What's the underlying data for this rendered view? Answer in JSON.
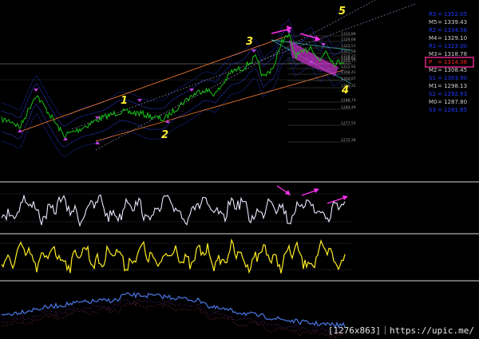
{
  "chart_data": [
    {
      "type": "line",
      "panel": "price",
      "series": [],
      "wave_labels": [
        "1",
        "2",
        "3",
        "4",
        "5"
      ],
      "pivot_levels": [
        {
          "label": "R3",
          "value": "1352.05",
          "color": "#1e3cff",
          "highlight": false
        },
        {
          "label": "M5",
          "value": "1339.43",
          "color": "#d0d0d0",
          "highlight": false
        },
        {
          "label": "R2",
          "value": "1334.56",
          "color": "#1e3cff",
          "highlight": false
        },
        {
          "label": "M4",
          "value": "1329.10",
          "color": "#d0d0d0",
          "highlight": false
        },
        {
          "label": "R1",
          "value": "1323.00",
          "color": "#1e3cff",
          "highlight": false
        },
        {
          "label": "M3",
          "value": "1318.78",
          "color": "#d0d0d0",
          "highlight": false
        },
        {
          "label": "P",
          "value": "1314.36",
          "color": "#ff2020",
          "highlight": true
        },
        {
          "label": "M2",
          "value": "1308.45",
          "color": "#d0d0d0",
          "highlight": false
        },
        {
          "label": "S1",
          "value": "1303.90",
          "color": "#1e3cff",
          "highlight": false
        },
        {
          "label": "M1",
          "value": "1298.13",
          "color": "#d0d0d0",
          "highlight": false
        },
        {
          "label": "S2",
          "value": "1292.93",
          "color": "#1e3cff",
          "highlight": false
        },
        {
          "label": "M0",
          "value": "1287.80",
          "color": "#d0d0d0",
          "highlight": false
        },
        {
          "label": "S3",
          "value": "1281.85",
          "color": "#1e3cff",
          "highlight": false
        }
      ],
      "fib_levels": [
        "1333.89",
        "1329.68",
        "1325.51",
        "1321.58",
        "1318.27",
        "1316.94",
        "1315.77",
        "1311.92",
        "1308.41",
        "1304.07",
        "1298.35",
        "1288.74",
        "1284.49",
        "1277.55",
        "1275.38"
      ],
      "colors": {
        "price": "#18c018",
        "channel": "#ff8030",
        "upper_channel": "#606080",
        "arrow": "#ff33ee",
        "wave_label": "#ffee33"
      }
    },
    {
      "type": "line",
      "panel": "oscillator-1",
      "series": [],
      "colors": {
        "line": "#e8e8ff",
        "arrow": "#ff33ee"
      }
    },
    {
      "type": "line",
      "panel": "oscillator-2",
      "series": [],
      "colors": {
        "line": "#ffee22"
      }
    },
    {
      "type": "line",
      "panel": "oscillator-3",
      "series": [],
      "colors": {
        "line": "#4a78e8",
        "band": "#a040c0"
      }
    }
  ],
  "watermark": "[1276x863]｜https://upic.me/"
}
